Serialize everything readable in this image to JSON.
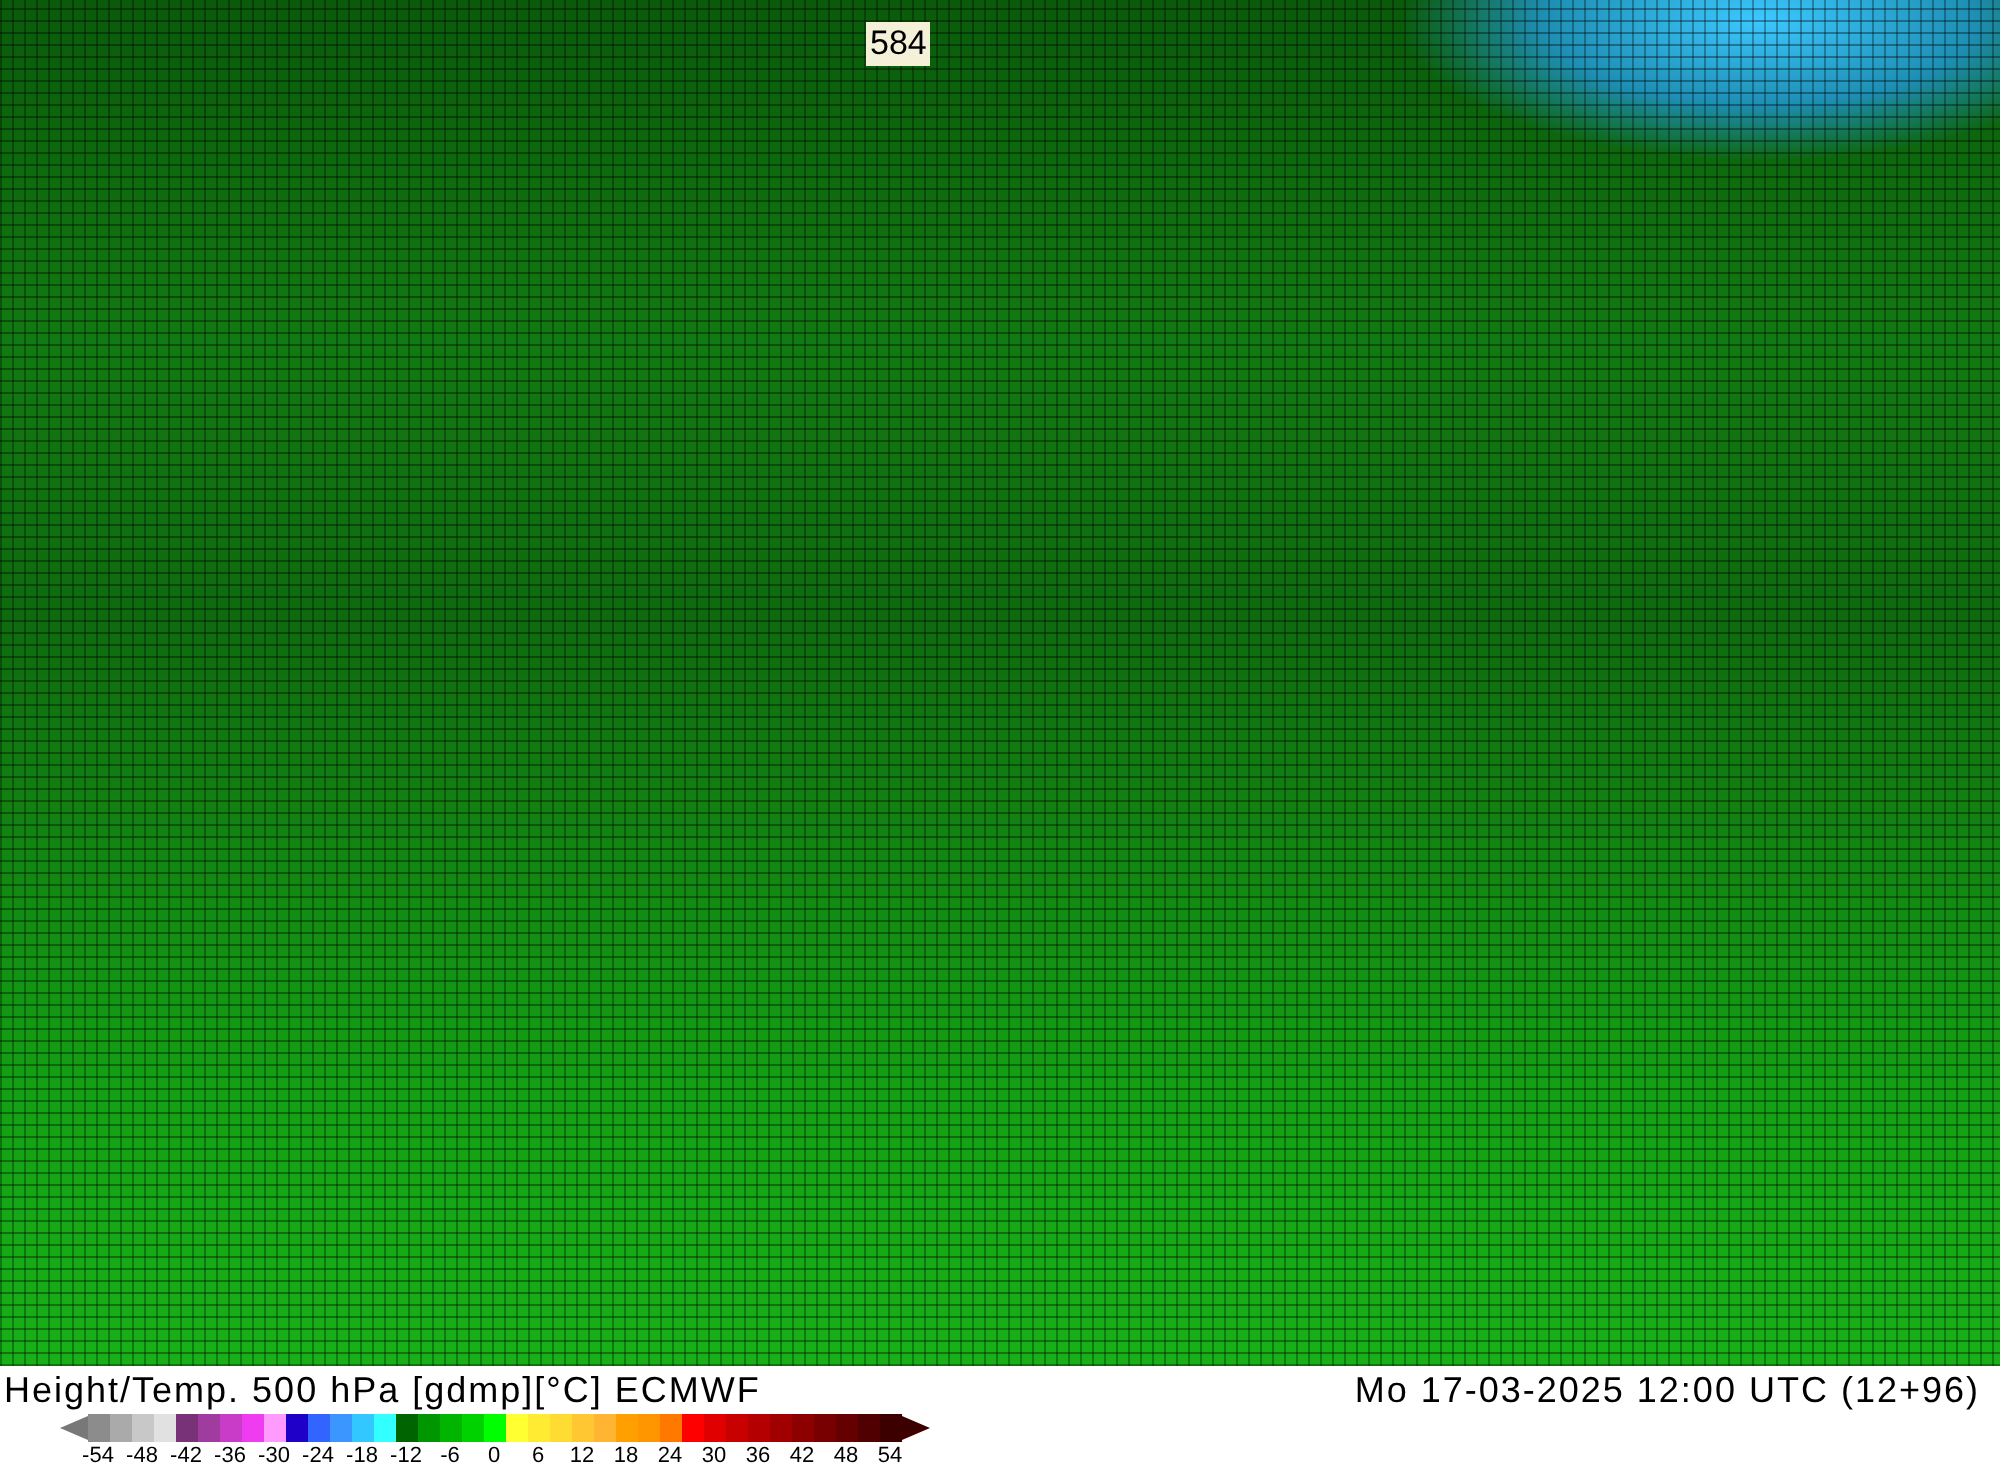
{
  "map": {
    "contour_label": "584"
  },
  "title": "Height/Temp. 500 hPa [gdmp][°C] ECMWF",
  "valid_time": "Mo 17-03-2025 12:00 UTC (12+96)",
  "legend": {
    "low_arrow": {
      "color": "#787878"
    },
    "high_arrow": {
      "color": "#3c0000"
    },
    "swatches": [
      {
        "color": "#8c8c8c"
      },
      {
        "color": "#aaaaaa"
      },
      {
        "color": "#c8c8c8"
      },
      {
        "color": "#e1e1e1"
      },
      {
        "color": "#783278"
      },
      {
        "color": "#a03ca0"
      },
      {
        "color": "#c83cc8"
      },
      {
        "color": "#f03cf0"
      },
      {
        "color": "#ff9bff"
      },
      {
        "color": "#1e00c8"
      },
      {
        "color": "#3264ff"
      },
      {
        "color": "#3c96ff"
      },
      {
        "color": "#32c8ff"
      },
      {
        "color": "#32ffff"
      },
      {
        "color": "#006400"
      },
      {
        "color": "#009600"
      },
      {
        "color": "#00b400"
      },
      {
        "color": "#00d200"
      },
      {
        "color": "#00ff00"
      },
      {
        "color": "#ffff32"
      },
      {
        "color": "#ffeb32"
      },
      {
        "color": "#ffdc32"
      },
      {
        "color": "#ffc832"
      },
      {
        "color": "#ffb432"
      },
      {
        "color": "#ffa000"
      },
      {
        "color": "#ff9600"
      },
      {
        "color": "#ff7800"
      },
      {
        "color": "#ff0000"
      },
      {
        "color": "#e10000"
      },
      {
        "color": "#c80000"
      },
      {
        "color": "#b40000"
      },
      {
        "color": "#a00000"
      },
      {
        "color": "#8c0000"
      },
      {
        "color": "#780000"
      },
      {
        "color": "#640000"
      },
      {
        "color": "#500000"
      },
      {
        "color": "#3c0000"
      }
    ],
    "ticks": [
      "-54",
      "-48",
      "-42",
      "-36",
      "-30",
      "-24",
      "-18",
      "-12",
      "-6",
      "0",
      "6",
      "12",
      "18",
      "24",
      "30",
      "36",
      "42",
      "48",
      "54"
    ]
  }
}
